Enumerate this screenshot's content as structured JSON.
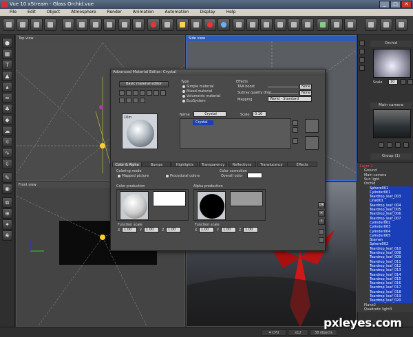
{
  "window": {
    "title": "Vue 10 xStream - Glass Orchid.vue",
    "buttons": [
      "_",
      "□",
      "✕"
    ]
  },
  "menu": [
    "File",
    "Edit",
    "Object",
    "Atmosphere",
    "Render",
    "Animation",
    "Automation",
    "Display",
    "Help"
  ],
  "viewports": {
    "top": "Top view",
    "side": "Side view",
    "front": "Front view"
  },
  "right_panel": {
    "object_name": "Orchid",
    "scale_label": "Scale",
    "scale_value": "10",
    "camera_label": "Main camera",
    "group_label": "Group (1)"
  },
  "scene_tree": [
    "Layer 1",
    "Ground",
    "Main camera",
    "Sun light",
    "Orchid",
    "Sphere001",
    "Cylinder001",
    "Teardrop_leaf_003",
    "Line001",
    "Teardrop_leaf_004",
    "Teardrop_leaf_005",
    "Teardrop_leaf_006",
    "Teardrop_leaf_007",
    "Cylinder002",
    "Cylinder003",
    "Cylinder004",
    "Cylinder005",
    "Stamen",
    "Sphere002",
    "Teardrop_leaf_010",
    "Teardrop_leaf_008",
    "Teardrop_leaf_009",
    "Teardrop_leaf_011",
    "Teardrop_leaf_012",
    "Teardrop_leaf_013",
    "Teardrop_leaf_014",
    "Teardrop_leaf_015",
    "Teardrop_leaf_016",
    "Teardrop_leaf_017",
    "Teardrop_leaf_018",
    "Teardrop_leaf_019",
    "Teardrop_leaf_020",
    "Plane2",
    "Quadratic light3"
  ],
  "material_editor": {
    "title": "Advanced Material Editor: Crystal",
    "basic_button": "Basic material editor",
    "type_label": "Type",
    "types": [
      "Simple material",
      "Mixed material",
      "Volumetric material",
      "EcoSystem"
    ],
    "effects_label": "Effects",
    "taa_label": "TAA boost",
    "taa_value": "None",
    "subray_label": "Subray quality drop",
    "subray_value": "None",
    "mapping_label": "Mapping",
    "mapping_value": "World - Standard",
    "name_label": "Name",
    "name_value": "Crystal",
    "scale_label": "Scale",
    "scale_value": "0.10",
    "layer_item": "Crystal",
    "preview_label": "10m",
    "tabs": [
      "Color & Alpha",
      "Bumps",
      "Highlights",
      "Transparency",
      "Reflections",
      "Translucency",
      "Effects"
    ],
    "coloring_mode_label": "Coloring mode",
    "mapped_picture": "Mapped picture",
    "procedural_colors": "Procedural colors",
    "color_correction_label": "Color correction",
    "overall_color_label": "Overall color",
    "color_production_label": "Color production",
    "alpha_production_label": "Alpha production",
    "function_scale_label": "Function scale",
    "func_xyz": [
      "X",
      "Y",
      "Z"
    ],
    "func_vals": [
      "1.00",
      "1.00",
      "1.00"
    ],
    "side_buttons": [
      "OK",
      "✕",
      "?"
    ]
  },
  "status": {
    "cpu": "4 CPU",
    "zoom": "x12",
    "objects": "38 objects"
  },
  "watermark": "pxleyes.com"
}
